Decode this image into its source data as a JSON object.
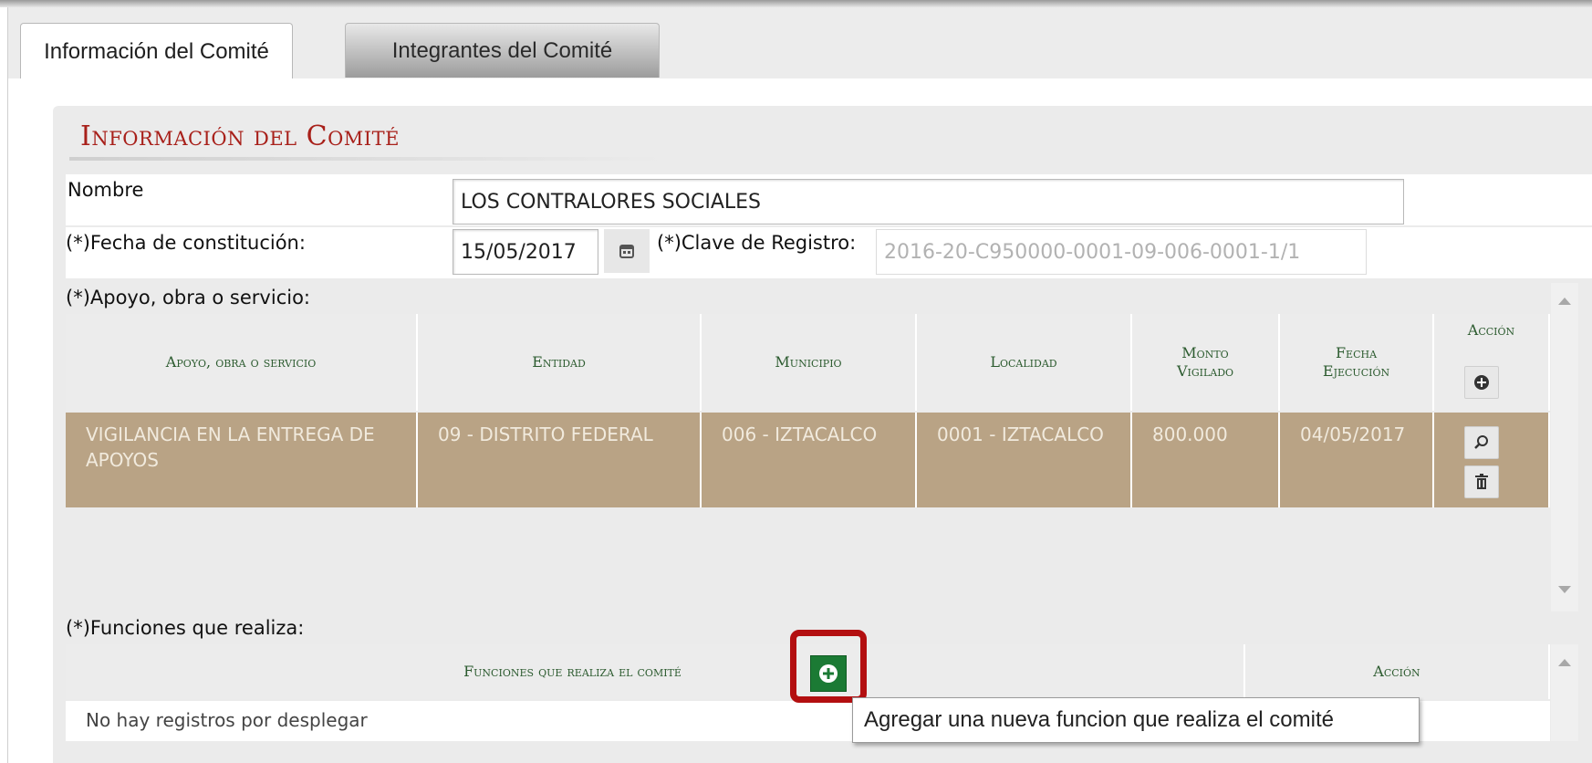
{
  "tabs": [
    {
      "label": "Información del Comité",
      "active": true
    },
    {
      "label": "Integrantes del Comité",
      "active": false
    }
  ],
  "section": {
    "title": "Información del Comité"
  },
  "form": {
    "nombre_label": "Nombre",
    "nombre_value": "LOS CONTRALORES SOCIALES",
    "fecha_label": "(*)Fecha de constitución:",
    "fecha_value": "15/05/2017",
    "clave_label": "(*)Clave de Registro:",
    "clave_value": "2016-20-C950000-0001-09-006-0001-1/1",
    "apoyo_label": "(*)Apoyo, obra o servicio:",
    "funciones_label": "(*)Funciones que realiza:"
  },
  "apoyos_table": {
    "headers": [
      "Apoyo, obra o servicio",
      "Entidad",
      "Municipio",
      "Localidad",
      "Monto Vigilado",
      "Fecha Ejecución",
      "Acción"
    ],
    "rows": [
      [
        "VIGILANCIA EN LA ENTREGA DE APOYOS",
        "09 - DISTRITO FEDERAL",
        "006 - IZTACALCO",
        "0001 - IZTACALCO",
        "800.000",
        "04/05/2017"
      ]
    ]
  },
  "funciones_table": {
    "headers": [
      "Funciones que realiza el comité",
      "Acción"
    ],
    "empty_message": "No hay registros por desplegar"
  },
  "tooltip": "Agregar una nueva funcion que realiza el comité",
  "colors": {
    "title_red": "#a8201a",
    "header_green": "#2c5b2f",
    "selected_row": "#b9a385",
    "add_green": "#1b7a34",
    "highlight": "#b30f10"
  },
  "icons": {
    "calendar": "calendar-icon",
    "add": "plus-circle-icon",
    "view": "magnifier-icon",
    "delete": "trash-icon"
  }
}
